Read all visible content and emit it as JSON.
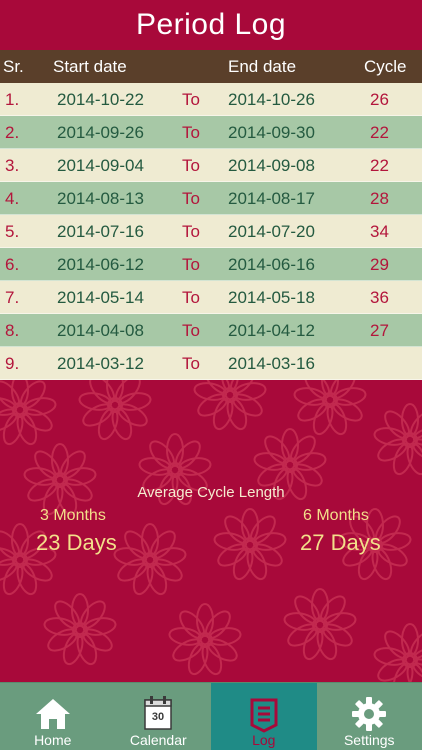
{
  "header": {
    "title": "Period Log"
  },
  "table": {
    "columns": {
      "sr": "Sr.",
      "start": "Start date",
      "end": "End date",
      "cycle": "Cycle"
    },
    "rows": [
      {
        "sr": "1.",
        "start": "2014-10-22",
        "to": "To",
        "end": "2014-10-26",
        "cycle": "26"
      },
      {
        "sr": "2.",
        "start": "2014-09-26",
        "to": "To",
        "end": "2014-09-30",
        "cycle": "22"
      },
      {
        "sr": "3.",
        "start": "2014-09-04",
        "to": "To",
        "end": "2014-09-08",
        "cycle": "22"
      },
      {
        "sr": "4.",
        "start": "2014-08-13",
        "to": "To",
        "end": "2014-08-17",
        "cycle": "28"
      },
      {
        "sr": "5.",
        "start": "2014-07-16",
        "to": "To",
        "end": "2014-07-20",
        "cycle": "34"
      },
      {
        "sr": "6.",
        "start": "2014-06-12",
        "to": "To",
        "end": "2014-06-16",
        "cycle": "29"
      },
      {
        "sr": "7.",
        "start": "2014-05-14",
        "to": "To",
        "end": "2014-05-18",
        "cycle": "36"
      },
      {
        "sr": "8.",
        "start": "2014-04-08",
        "to": "To",
        "end": "2014-04-12",
        "cycle": "27"
      },
      {
        "sr": "9.",
        "start": "2014-03-12",
        "to": "To",
        "end": "2014-03-16",
        "cycle": ""
      }
    ]
  },
  "average": {
    "title": "Average Cycle Length",
    "three_months": {
      "label": "3 Months",
      "value": "23 Days"
    },
    "six_months": {
      "label": "6 Months",
      "value": "27 Days"
    }
  },
  "tabbar": {
    "items": [
      {
        "label": "Home",
        "icon": "home-icon"
      },
      {
        "label": "Calendar",
        "icon": "calendar-icon",
        "icon_text": "30"
      },
      {
        "label": "Log",
        "icon": "log-icon"
      },
      {
        "label": "Settings",
        "icon": "gear-icon"
      }
    ],
    "active": "Log"
  },
  "colors": {
    "background": "#a8093a",
    "header_row": "#5a3f2a",
    "row_light": "#efebd2",
    "row_dark": "#a7c8a6",
    "tabbar": "#6a9c7e",
    "tab_active": "#1f8b86",
    "accent_yellow": "#f3df8a"
  }
}
